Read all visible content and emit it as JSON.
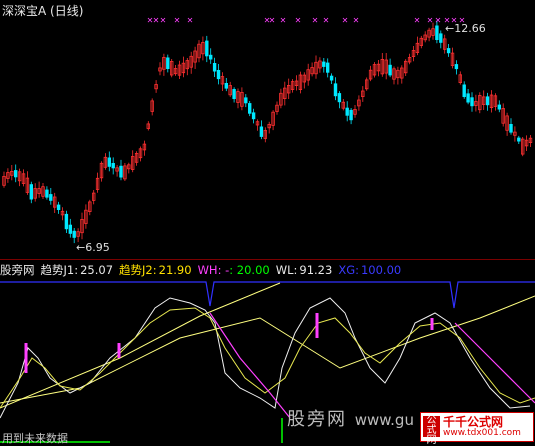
{
  "header": {
    "name": "深深宝A",
    "period": "(日线)"
  },
  "price_panel": {
    "high_label": "12.66",
    "low_label": "6.95",
    "up_color": "#ff3030",
    "down_color": "#00e8ff",
    "marker_color": "#ff40ff",
    "marker_glyph": "✕",
    "arrow_glyph": "←"
  },
  "indicator_bar": {
    "site": "股旁网",
    "j1_label": "趋势J1:",
    "j1_value": "25.07",
    "j2_label": "趋势J2:",
    "j2_value": "21.90",
    "wh_label": "WH: -",
    "wh_value": ": 20.00",
    "wl_label": "WL:",
    "wl_value": "91.23",
    "xg_label": "XG:",
    "xg_value": "100.00"
  },
  "footer": {
    "text": "用到未来数据"
  },
  "watermark": {
    "left_text": "股旁网",
    "left_suffix": "www.gu",
    "right_title": "千千公式网",
    "right_url": "www.tdx001.com",
    "seal_text": "公式网"
  }
}
